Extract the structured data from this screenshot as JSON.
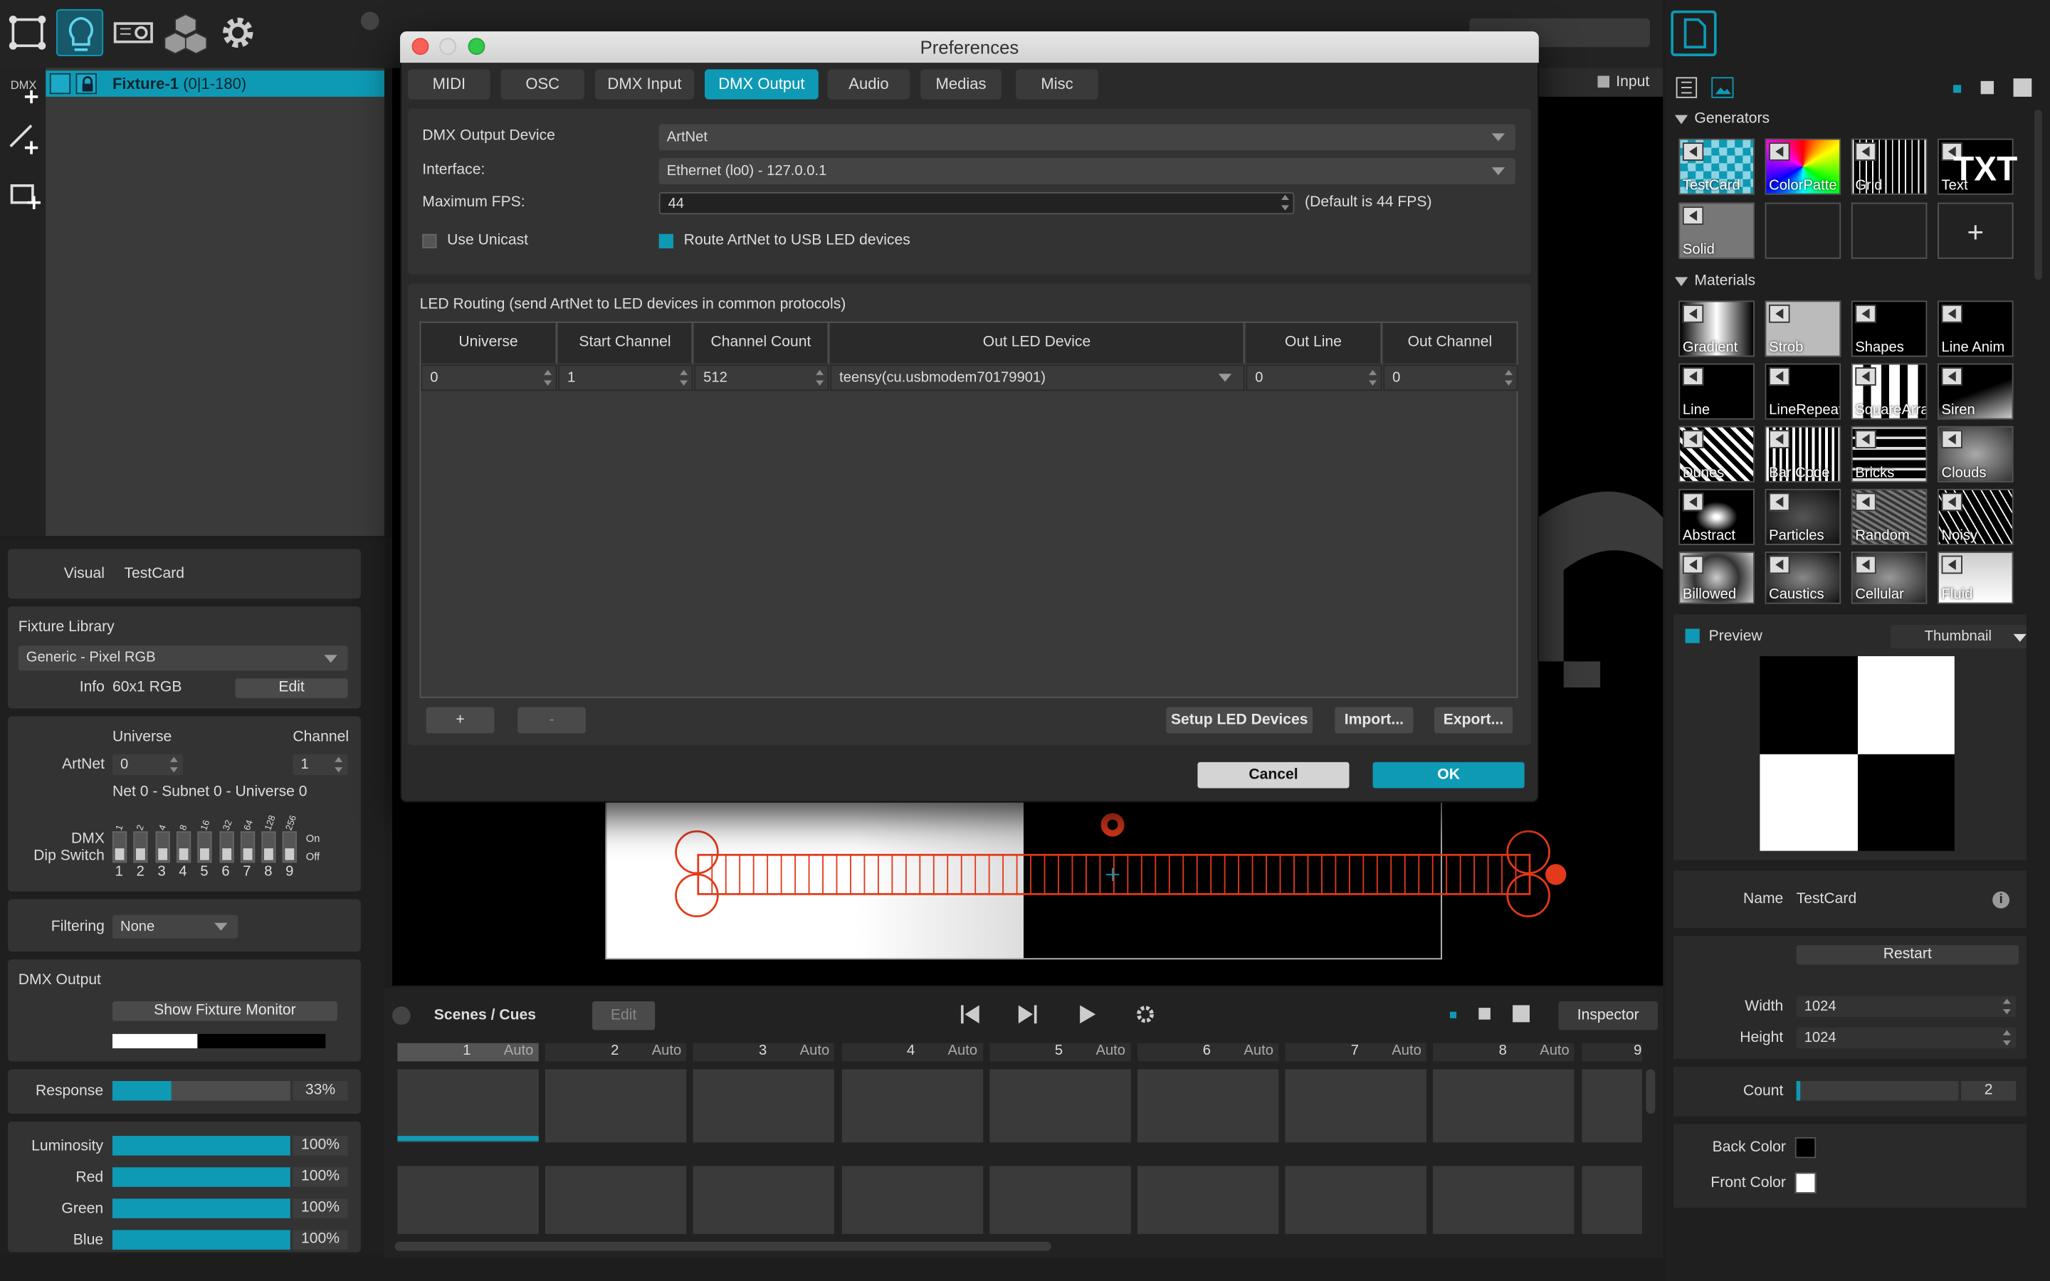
{
  "toolbar": {
    "icons": [
      "output-mapping-icon",
      "fixture-bulb-icon",
      "projector-icon",
      "cubes-icon",
      "settings-gear-icon"
    ]
  },
  "fixture_header": {
    "name": "Fixture-1",
    "range": "(0|1-180)",
    "dmx_label": "DMX"
  },
  "visual": {
    "label": "Visual",
    "value": "TestCard"
  },
  "fixture_library": {
    "title": "Fixture Library",
    "selected": "Generic - Pixel RGB",
    "info_label": "Info",
    "info_value": "60x1 RGB",
    "edit": "Edit"
  },
  "artnet": {
    "universe_label": "Universe",
    "channel_label": "Channel",
    "label": "ArtNet",
    "universe": "0",
    "channel": "1",
    "net_info": "Net 0 - Subnet 0 - Universe 0"
  },
  "dip": {
    "title1": "DMX",
    "title2": "Dip Switch",
    "values": [
      "1",
      "2",
      "4",
      "8",
      "16",
      "32",
      "64",
      "128",
      "256"
    ],
    "numbers": [
      "1",
      "2",
      "3",
      "4",
      "5",
      "6",
      "7",
      "8",
      "9"
    ],
    "on": "On",
    "off": "Off"
  },
  "filtering": {
    "label": "Filtering",
    "value": "None"
  },
  "dmx_output": {
    "title": "DMX Output",
    "button": "Show Fixture Monitor"
  },
  "response": {
    "label": "Response",
    "value": "33%",
    "level": 0.33
  },
  "color": [
    {
      "label": "Luminosity",
      "value": "100%"
    },
    {
      "label": "Red",
      "value": "100%"
    },
    {
      "label": "Green",
      "value": "100%"
    },
    {
      "label": "Blue",
      "value": "100%"
    }
  ],
  "dialog": {
    "title": "Preferences",
    "tabs": [
      "MIDI",
      "OSC",
      "DMX Input",
      "DMX Output",
      "Audio",
      "Medias",
      "Misc"
    ],
    "active_tab": "DMX Output",
    "device_label": "DMX Output Device",
    "device_value": "ArtNet",
    "interface_label": "Interface:",
    "interface_value": "Ethernet (lo0) - 127.0.0.1",
    "fps_label": "Maximum FPS:",
    "fps_value": "44",
    "fps_hint": "(Default is 44 FPS)",
    "unicast_label": "Use Unicast",
    "route_label": "Route ArtNet to USB LED devices",
    "routing_title": "LED Routing (send ArtNet to LED devices in common protocols)",
    "columns": [
      "Universe",
      "Start Channel",
      "Channel Count",
      "Out LED Device",
      "Out Line",
      "Out Channel"
    ],
    "row": [
      "0",
      "1",
      "512",
      "teensy(cu.usbmodem70179901)",
      "0",
      "0"
    ],
    "add": "+",
    "remove": "-",
    "setup": "Setup LED Devices",
    "import": "Import...",
    "export": "Export...",
    "cancel": "Cancel",
    "ok": "OK"
  },
  "right": {
    "input_label": "Input",
    "generators_title": "Generators",
    "generators": [
      "TestCard",
      "ColorPatte",
      "Grid",
      "Text",
      "Solid"
    ],
    "text_glyph": "TXT",
    "add": "+",
    "materials_title": "Materials",
    "materials": [
      "Gradient",
      "Strob",
      "Shapes",
      "Line Anim",
      "Line",
      "LineRepeat",
      "SquareArra",
      "Siren",
      "Dunes",
      "Bar Code",
      "Bricks",
      "Clouds",
      "Abstract",
      "Particles",
      "Random",
      "Noisy",
      "Billowed",
      "Caustics",
      "Cellular",
      "Fluid"
    ],
    "preview_label": "Preview",
    "preview_mode": "Thumbnail",
    "name_label": "Name",
    "name_value": "TestCard",
    "restart": "Restart",
    "width_label": "Width",
    "width_value": "1024",
    "height_label": "Height",
    "height_value": "1024",
    "count_label": "Count",
    "count_value": "2",
    "back_color_label": "Back Color",
    "front_color_label": "Front Color",
    "back_color": "#000000",
    "front_color": "#ffffff"
  },
  "cues": {
    "title": "Scenes / Cues",
    "edit": "Edit",
    "inspector": "Inspector",
    "auto": "Auto",
    "numbers": [
      "1",
      "2",
      "3",
      "4",
      "5",
      "6",
      "7",
      "8",
      "9"
    ]
  },
  "colors": {
    "accent": "#0e9ab5",
    "fixture_red": "#e23a1a",
    "dialog_bg": "#2a2a2a"
  }
}
